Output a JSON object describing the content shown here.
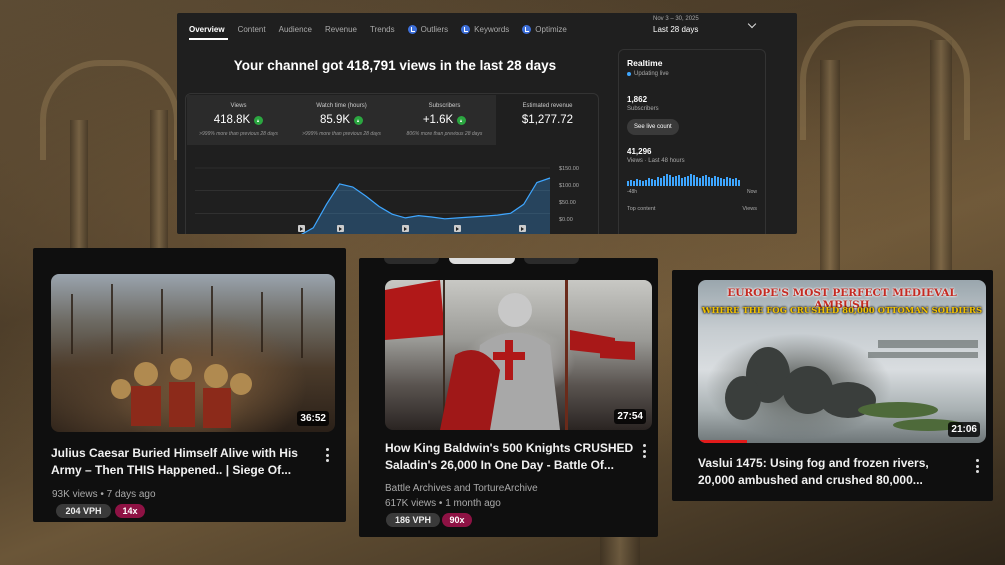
{
  "analytics": {
    "tabs": [
      {
        "label": "Overview",
        "active": true,
        "icon": ""
      },
      {
        "label": "Content",
        "active": false,
        "icon": ""
      },
      {
        "label": "Audience",
        "active": false,
        "icon": ""
      },
      {
        "label": "Revenue",
        "active": false,
        "icon": ""
      },
      {
        "label": "Trends",
        "active": false,
        "icon": ""
      },
      {
        "label": "Outliers",
        "active": false,
        "icon": "check-badge-icon"
      },
      {
        "label": "Keywords",
        "active": false,
        "icon": "check-badge-icon"
      },
      {
        "label": "Optimize",
        "active": false,
        "icon": "check-badge-icon"
      }
    ],
    "date_range": "Nov 3 – 30, 2025",
    "date_label": "Last 28 days",
    "headline": "Your channel got 418,791 views in the last 28 days",
    "stats": [
      {
        "label": "Views",
        "value": "418.8K",
        "sub": ">999% more than previous 28 days"
      },
      {
        "label": "Watch time (hours)",
        "value": "85.9K",
        "sub": ">999% more than previous 28 days"
      },
      {
        "label": "Subscribers",
        "value": "+1.6K",
        "sub": "806% more than previous 28 days"
      },
      {
        "label": "Estimated revenue",
        "value": "$1,277.72",
        "sub": ""
      }
    ],
    "chart_data": {
      "type": "area",
      "x": [
        1,
        2,
        3,
        4,
        5,
        6,
        7,
        8,
        9,
        10,
        11,
        12,
        13,
        14,
        15,
        16,
        17,
        18,
        19,
        20,
        21,
        22,
        23,
        24,
        25,
        26,
        27,
        28
      ],
      "values": [
        0,
        0,
        0,
        0,
        0,
        0,
        0,
        0,
        2,
        18,
        70,
        115,
        108,
        88,
        65,
        48,
        40,
        45,
        42,
        38,
        40,
        42,
        44,
        46,
        50,
        70,
        118,
        128
      ],
      "ylim": [
        0,
        150
      ],
      "ytick_labels": [
        "$150.00",
        "$100.00",
        "$50.00",
        "$0.00"
      ],
      "color": "#3ea6ff"
    },
    "realtime": {
      "title": "Realtime",
      "live": "Updating live",
      "subscribers": "1,862",
      "subscribers_label": "Subscribers",
      "button": "See live count",
      "views": "41,296",
      "views_label": "Views · Last 48 hours",
      "axis_left": "-48h",
      "axis_right": "Now",
      "foot_left": "Top content",
      "foot_right": "Views"
    }
  },
  "videos": [
    {
      "title": "Julius Caesar Buried Himself Alive with His Army – Then THIS Happened.. | Siege Of...",
      "duration": "36:52",
      "meta1": "93K views • 7 days ago",
      "meta2": "",
      "vph": "204 VPH",
      "multiplier": "14x"
    },
    {
      "title": "How King Baldwin's 500 Knights CRUSHED Saladin's 26,000 In One Day - Battle Of...",
      "duration": "27:54",
      "meta1": "Battle Archives and TortureArchive",
      "meta2": "617K views • 1 month ago",
      "vph": "186 VPH",
      "multiplier": "90x"
    },
    {
      "title": "Vaslui 1475: Using fog and frozen rivers, 20,000 ambushed and crushed 80,000...",
      "duration": "21:06",
      "thumb_line1": "EUROPE'S MOST PERFECT MEDIEVAL AMBUSH",
      "thumb_line2": "WHERE THE FOG CRUSHED 80,000 OTTOMAN SOLDIERS",
      "progress": 0.17
    }
  ]
}
